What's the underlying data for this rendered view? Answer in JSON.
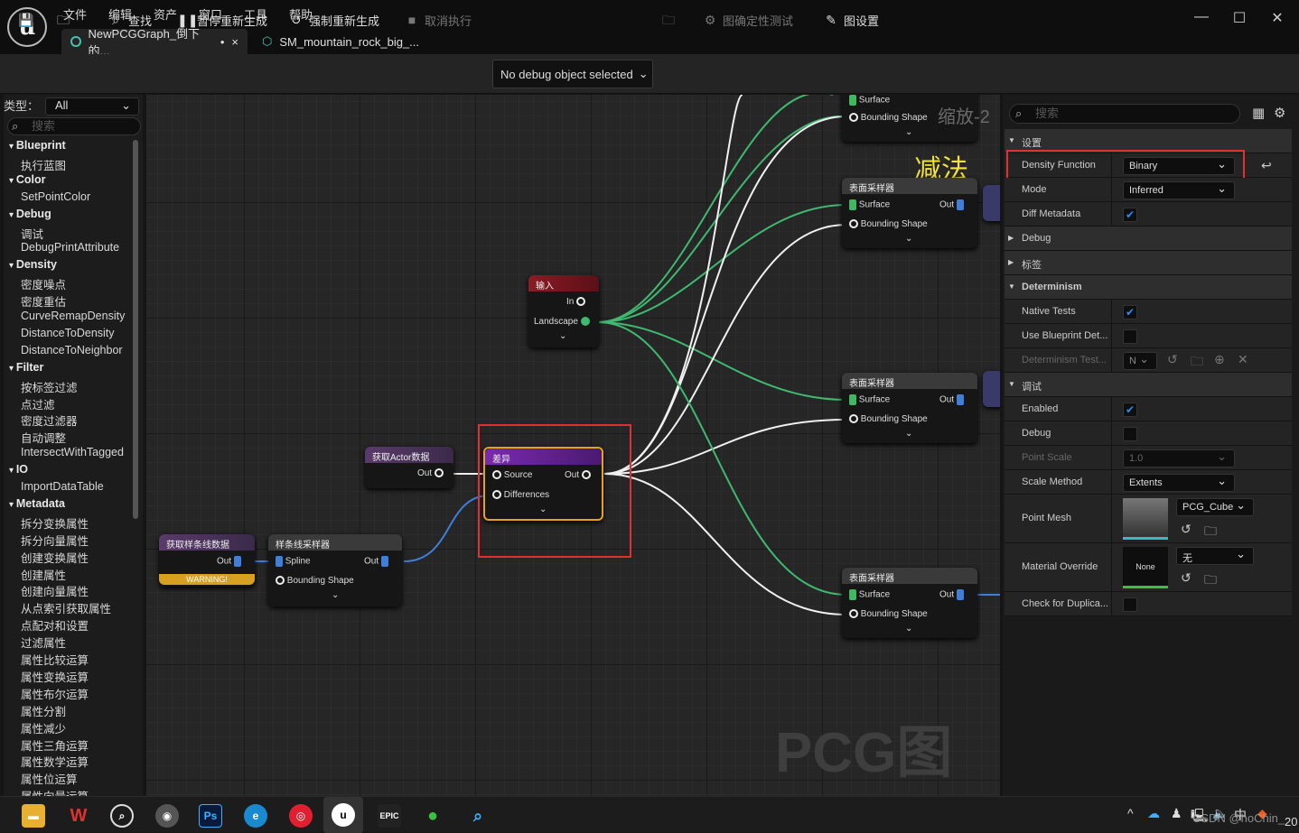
{
  "menu": [
    "文件",
    "编辑",
    "资产",
    "窗口",
    "工具",
    "帮助"
  ],
  "tabs": [
    {
      "label": "NewPCGGraph_倒下的...",
      "modified": "•",
      "close": "×"
    },
    {
      "label": "SM_mountain_rock_big_..."
    }
  ],
  "window": {
    "min": "—",
    "max": "☐",
    "close": "✕"
  },
  "toolbar": {
    "find": "查找",
    "pause": "暂停重新生成",
    "force": "强制重新生成",
    "cancel": "取消执行",
    "debug_select": "No debug object selected",
    "determinism": "图确定性测试",
    "graph_settings": "图设置"
  },
  "palette": {
    "type_label": "类型：",
    "type_value": "All",
    "search_placeholder": "搜索",
    "entries": [
      {
        "t": "cat",
        "label": "Blueprint"
      },
      {
        "t": "item",
        "label": "执行蓝图"
      },
      {
        "t": "cat",
        "label": "Color"
      },
      {
        "t": "item",
        "label": "SetPointColor"
      },
      {
        "t": "cat",
        "label": "Debug"
      },
      {
        "t": "item",
        "label": "调试"
      },
      {
        "t": "item",
        "label": "DebugPrintAttribute"
      },
      {
        "t": "cat",
        "label": "Density"
      },
      {
        "t": "item",
        "label": "密度噪点"
      },
      {
        "t": "item",
        "label": "密度重估"
      },
      {
        "t": "item",
        "label": "CurveRemapDensity"
      },
      {
        "t": "item",
        "label": "DistanceToDensity"
      },
      {
        "t": "item",
        "label": "DistanceToNeighbor"
      },
      {
        "t": "cat",
        "label": "Filter"
      },
      {
        "t": "item",
        "label": "按标签过滤"
      },
      {
        "t": "item",
        "label": "点过滤"
      },
      {
        "t": "item",
        "label": "密度过滤器"
      },
      {
        "t": "item",
        "label": "自动调整"
      },
      {
        "t": "item",
        "label": "IntersectWithTagged"
      },
      {
        "t": "cat",
        "label": "IO"
      },
      {
        "t": "item",
        "label": "ImportDataTable"
      },
      {
        "t": "cat",
        "label": "Metadata"
      },
      {
        "t": "item",
        "label": "拆分变换属性"
      },
      {
        "t": "item",
        "label": "拆分向量属性"
      },
      {
        "t": "item",
        "label": "创建变换属性"
      },
      {
        "t": "item",
        "label": "创建属性"
      },
      {
        "t": "item",
        "label": "创建向量属性"
      },
      {
        "t": "item",
        "label": "从点索引获取属性"
      },
      {
        "t": "item",
        "label": "点配对和设置"
      },
      {
        "t": "item",
        "label": "过滤属性"
      },
      {
        "t": "item",
        "label": "属性比较运算"
      },
      {
        "t": "item",
        "label": "属性变换运算"
      },
      {
        "t": "item",
        "label": "属性布尔运算"
      },
      {
        "t": "item",
        "label": "属性分割"
      },
      {
        "t": "item",
        "label": "属性减少"
      },
      {
        "t": "item",
        "label": "属性三角运算"
      },
      {
        "t": "item",
        "label": "属性数学运算"
      },
      {
        "t": "item",
        "label": "属性位运算"
      },
      {
        "t": "item",
        "label": "属性向量运算"
      }
    ]
  },
  "graph": {
    "watermark": "PCG图表",
    "zoom": "缩放-2",
    "annotation": "减法",
    "nodes": {
      "input": {
        "title": "输入",
        "in": "In",
        "landscape": "Landscape"
      },
      "getactor": {
        "title": "获取Actor数据",
        "out": "Out"
      },
      "diff": {
        "title": "差异",
        "source": "Source",
        "differences": "Differences",
        "out": "Out"
      },
      "getspline": {
        "title": "获取样条线数据",
        "out": "Out",
        "warning": "WARNING!"
      },
      "splinesampler": {
        "title": "样条线采样器",
        "spline": "Spline",
        "bounding": "Bounding Shape",
        "out": "Out"
      },
      "surf0": {
        "surface": "Surface",
        "bounding": "Bounding Shape",
        "out": "Out"
      },
      "surf1": {
        "title": "表面采样器",
        "surface": "Surface",
        "bounding": "Bounding Shape",
        "out": "Out"
      },
      "surf2": {
        "title": "表面采样器",
        "surface": "Surface",
        "bounding": "Bounding Shape",
        "out": "Out"
      },
      "surf3": {
        "title": "表面采样器",
        "surface": "Surface",
        "bounding": "Bounding Shape",
        "out": "Out"
      }
    }
  },
  "details": {
    "search_placeholder": "搜索",
    "rows": [
      {
        "k": "sec",
        "label": "设置"
      },
      {
        "k": "drop",
        "label": "Density Function",
        "value": "Binary",
        "hl": true
      },
      {
        "k": "drop",
        "label": "Mode",
        "value": "Inferred"
      },
      {
        "k": "chk",
        "label": "Diff Metadata",
        "checked": true
      },
      {
        "k": "col",
        "label": "Debug"
      },
      {
        "k": "col",
        "label": "标签"
      },
      {
        "k": "sec",
        "label": "Determinism",
        "bold": true
      },
      {
        "k": "chk",
        "label": "Native Tests",
        "checked": true
      },
      {
        "k": "chk",
        "label": "Use Blueprint Det...",
        "checked": false
      },
      {
        "k": "dim",
        "label": "Determinism Test...",
        "value": "N"
      },
      {
        "k": "sec",
        "label": "调试"
      },
      {
        "k": "chk",
        "label": "Enabled",
        "checked": true
      },
      {
        "k": "chk",
        "label": "Debug",
        "checked": false
      },
      {
        "k": "num",
        "label": "Point Scale",
        "value": "1.0",
        "dim": true
      },
      {
        "k": "drop",
        "label": "Scale Method",
        "value": "Extents"
      },
      {
        "k": "mesh",
        "label": "Point Mesh",
        "value": "PCG_Cube"
      },
      {
        "k": "mat",
        "label": "Material Override",
        "value": "无",
        "thumb": "None"
      },
      {
        "k": "chk",
        "label": "Check for Duplica...",
        "checked": false
      }
    ]
  },
  "taskbar": {
    "tray": "中",
    "corner": "20",
    "watermark": "CSDN @hoChin_"
  }
}
